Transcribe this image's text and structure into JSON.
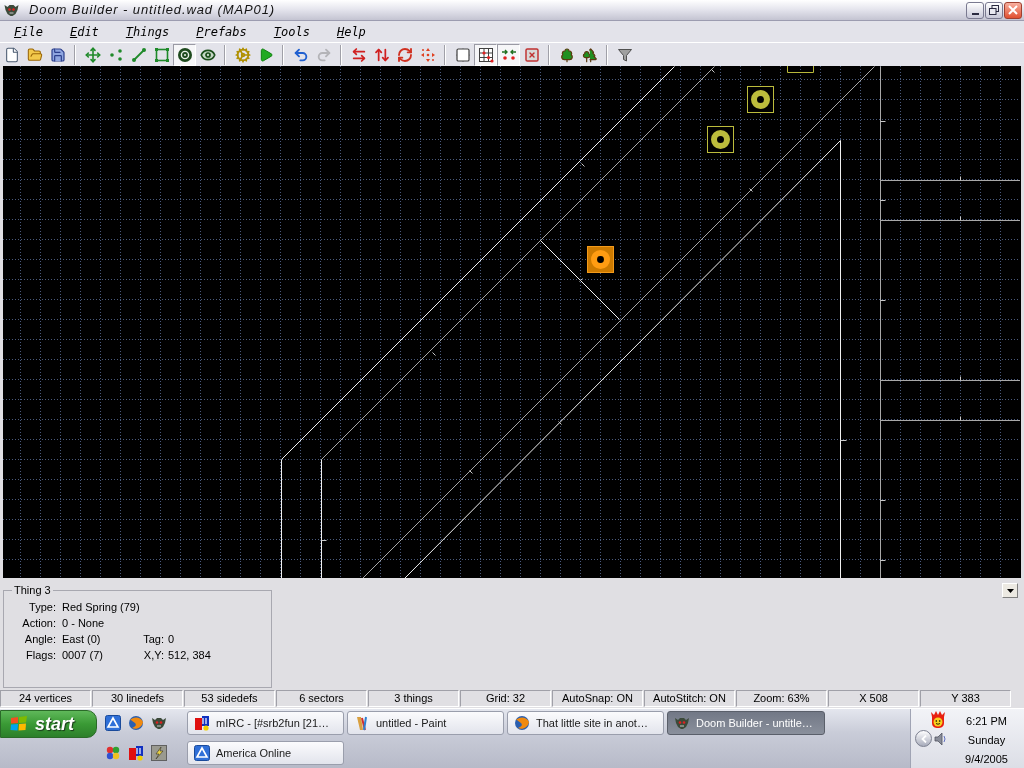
{
  "window": {
    "title": "Doom Builder - untitled.wad (MAP01)"
  },
  "menu": [
    "File",
    "Edit",
    "Things",
    "Prefabs",
    "Tools",
    "Help"
  ],
  "toolbar": {
    "groups": [
      [
        {
          "pressed": false,
          "disabled": false
        },
        {
          "pressed": false,
          "disabled": false
        },
        {
          "pressed": false,
          "disabled": false
        }
      ],
      [
        {
          "pressed": false,
          "disabled": false
        },
        {
          "pressed": false,
          "disabled": false
        },
        {
          "pressed": false,
          "disabled": false
        },
        {
          "pressed": false,
          "disabled": false
        },
        {
          "pressed": true,
          "disabled": false
        },
        {
          "pressed": false,
          "disabled": false
        }
      ],
      [
        {
          "pressed": false,
          "disabled": false
        },
        {
          "pressed": false,
          "disabled": false
        }
      ],
      [
        {
          "pressed": false,
          "disabled": false
        },
        {
          "pressed": false,
          "disabled": true
        }
      ],
      [
        {
          "pressed": false,
          "disabled": false
        },
        {
          "pressed": false,
          "disabled": false
        },
        {
          "pressed": false,
          "disabled": false
        },
        {
          "pressed": false,
          "disabled": false
        }
      ],
      [
        {
          "pressed": false,
          "disabled": false
        },
        {
          "pressed": true,
          "disabled": false
        },
        {
          "pressed": true,
          "disabled": false
        },
        {
          "pressed": false,
          "disabled": false
        }
      ],
      [
        {
          "pressed": false,
          "disabled": false
        },
        {
          "pressed": false,
          "disabled": false
        }
      ],
      [
        {
          "pressed": false,
          "disabled": false
        }
      ]
    ]
  },
  "map": {
    "things": [
      {
        "selected": false
      },
      {
        "selected": false
      },
      {
        "selected": true
      }
    ]
  },
  "info_panel": {
    "title": "Thing 3",
    "rows": [
      [
        {
          "label": "Type:",
          "value": "Red Spring (79)"
        }
      ],
      [
        {
          "label": "Action:",
          "value": "0 - None"
        }
      ],
      [
        {
          "label": "Angle:",
          "value": "East (0)"
        },
        {
          "label": "Tag:",
          "value": "0"
        }
      ],
      [
        {
          "label": "Flags:",
          "value": "0007 (7)"
        },
        {
          "label": "X,Y:",
          "value": "512, 384"
        }
      ]
    ]
  },
  "status_bar": [
    "24 vertices",
    "30 linedefs",
    "53 sidedefs",
    "6 sectors",
    "3 things",
    "Grid: 32",
    "AutoSnap: ON",
    "AutoStitch: ON",
    "Zoom: 63%",
    "X 508",
    "Y 383"
  ],
  "taskbar": {
    "start_label": "start",
    "tasks": [
      {
        "label": "mIRC - [#srb2fun [21…",
        "selected": false
      },
      {
        "label": "untitled - Paint",
        "selected": false
      },
      {
        "label": "That little site in anot…",
        "selected": false
      },
      {
        "label": "Doom Builder - untitle…",
        "selected": true
      },
      {
        "label": "America Online",
        "selected": false
      }
    ],
    "clock": {
      "time": "6:21 PM",
      "day": "Sunday",
      "date": "9/4/2005"
    }
  }
}
